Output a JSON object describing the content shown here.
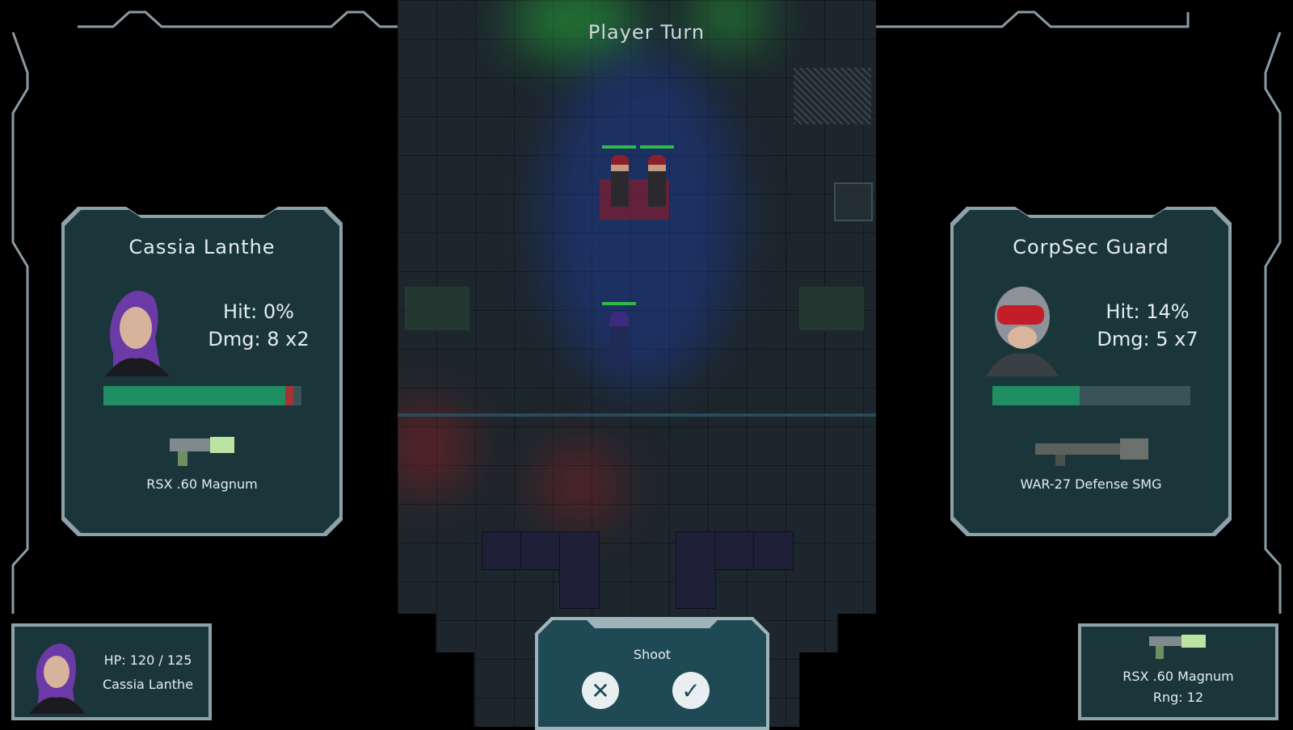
{
  "hud": {
    "turn_label": "Player Turn"
  },
  "attacker": {
    "name": "Cassia Lanthe",
    "hit_label": "Hit: 0%",
    "dmg_label": "Dmg: 8 x2",
    "hp_fraction": 0.92,
    "damage_preview_fraction": 0.04,
    "weapon": "RSX .60 Magnum",
    "portrait_icon": "purple-haired-woman-portrait"
  },
  "target": {
    "name": "CorpSec Guard",
    "hit_label": "Hit: 14%",
    "dmg_label": "Dmg: 5 x7",
    "hp_fraction": 0.44,
    "weapon": "WAR-27 Defense SMG",
    "portrait_icon": "red-visor-helmet-guard-portrait"
  },
  "unit_status": {
    "hp_label": "HP: 120 / 125",
    "name": "Cassia Lanthe"
  },
  "equipped_weapon": {
    "name": "RSX .60 Magnum",
    "range_label": "Rng: 12"
  },
  "action": {
    "title": "Shoot",
    "cancel_icon": "x-icon",
    "confirm_icon": "check-icon"
  },
  "colors": {
    "panel": "#1b363b",
    "panel_border": "#8ea1a9",
    "hp_green": "#1f8f63",
    "damage_red": "#a33434"
  }
}
